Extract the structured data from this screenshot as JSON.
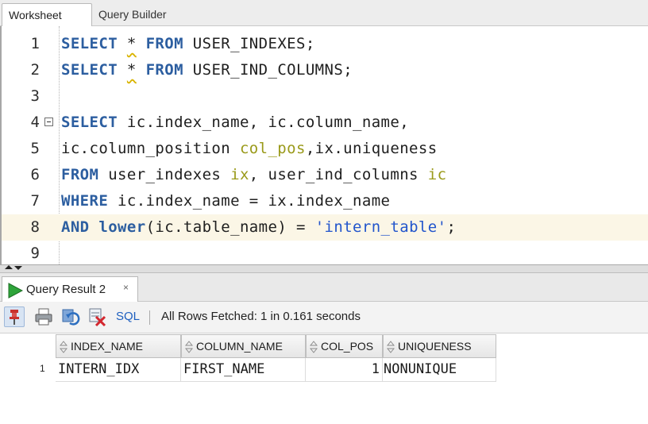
{
  "tabs": {
    "worksheet": "Worksheet",
    "query_builder": "Query Builder"
  },
  "editor": {
    "lines": [
      {
        "num": "1",
        "tokens": [
          {
            "t": "SELECT",
            "c": "kw"
          },
          {
            "t": " "
          },
          {
            "t": "*",
            "c": "star"
          },
          {
            "t": " "
          },
          {
            "t": "FROM",
            "c": "kw"
          },
          {
            "t": " USER_INDEXES;"
          }
        ]
      },
      {
        "num": "2",
        "tokens": [
          {
            "t": "SELECT",
            "c": "kw"
          },
          {
            "t": " "
          },
          {
            "t": "*",
            "c": "star"
          },
          {
            "t": " "
          },
          {
            "t": "FROM",
            "c": "kw"
          },
          {
            "t": " USER_IND_COLUMNS;"
          }
        ]
      },
      {
        "num": "3",
        "tokens": []
      },
      {
        "num": "4",
        "fold": true,
        "tokens": [
          {
            "t": "SELECT",
            "c": "kw"
          },
          {
            "t": " ic.index_name, ic.column_name,"
          }
        ]
      },
      {
        "num": "5",
        "tokens": [
          {
            "t": "ic.column_position "
          },
          {
            "t": "col_pos",
            "c": "alias"
          },
          {
            "t": ",ix.uniqueness"
          }
        ]
      },
      {
        "num": "6",
        "tokens": [
          {
            "t": "FROM",
            "c": "kw"
          },
          {
            "t": " user_indexes "
          },
          {
            "t": "ix",
            "c": "alias"
          },
          {
            "t": ", user_ind_columns "
          },
          {
            "t": "ic",
            "c": "alias"
          }
        ]
      },
      {
        "num": "7",
        "tokens": [
          {
            "t": "WHERE",
            "c": "kw"
          },
          {
            "t": " ic.index_name = ix.index_name"
          }
        ]
      },
      {
        "num": "8",
        "current": true,
        "tokens": [
          {
            "t": "AND",
            "c": "kw"
          },
          {
            "t": " "
          },
          {
            "t": "lower",
            "c": "fn"
          },
          {
            "t": "(ic.table_name) = "
          },
          {
            "t": "'intern_table'",
            "c": "str"
          },
          {
            "t": ";"
          }
        ]
      },
      {
        "num": "9",
        "tokens": []
      }
    ]
  },
  "result": {
    "tab_label": "Query Result 2",
    "close_glyph": "×",
    "toolbar": {
      "sql": "SQL",
      "status": "All Rows Fetched: 1 in 0.161 seconds"
    },
    "columns": [
      "INDEX_NAME",
      "COLUMN_NAME",
      "COL_POS",
      "UNIQUENESS"
    ],
    "rows": [
      {
        "num": "1",
        "cells": [
          "INTERN_IDX",
          "FIRST_NAME",
          "1",
          "NONUNIQUE"
        ]
      }
    ]
  },
  "colors": {
    "keyword": "#2c5ea0",
    "alias": "#9a9a1a",
    "string": "#2255cc",
    "current_line": "#fbf6e6"
  },
  "icons": [
    "run-icon",
    "pin-icon",
    "print-icon",
    "refresh-icon",
    "delete-icon",
    "sort-icon",
    "close-icon"
  ]
}
